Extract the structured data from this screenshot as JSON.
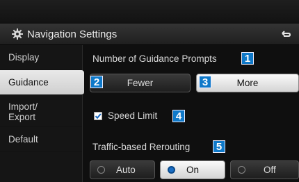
{
  "header": {
    "title": "Navigation Settings"
  },
  "sidebar": {
    "items": [
      {
        "label": "Display"
      },
      {
        "label": "Guidance"
      },
      {
        "label_line1": "Import/",
        "label_line2": "Export"
      },
      {
        "label": "Default"
      }
    ]
  },
  "guidance": {
    "prompts_label": "Number of Guidance Prompts",
    "fewer_label": "Fewer",
    "more_label": "More",
    "speed_limit_label": "Speed Limit",
    "speed_limit_checked": true,
    "rerouting_label": "Traffic-based Rerouting",
    "rerouting_options": [
      "Auto",
      "On",
      "Off"
    ],
    "rerouting_selected": "On"
  },
  "badges": [
    "1",
    "2",
    "3",
    "4",
    "5"
  ]
}
